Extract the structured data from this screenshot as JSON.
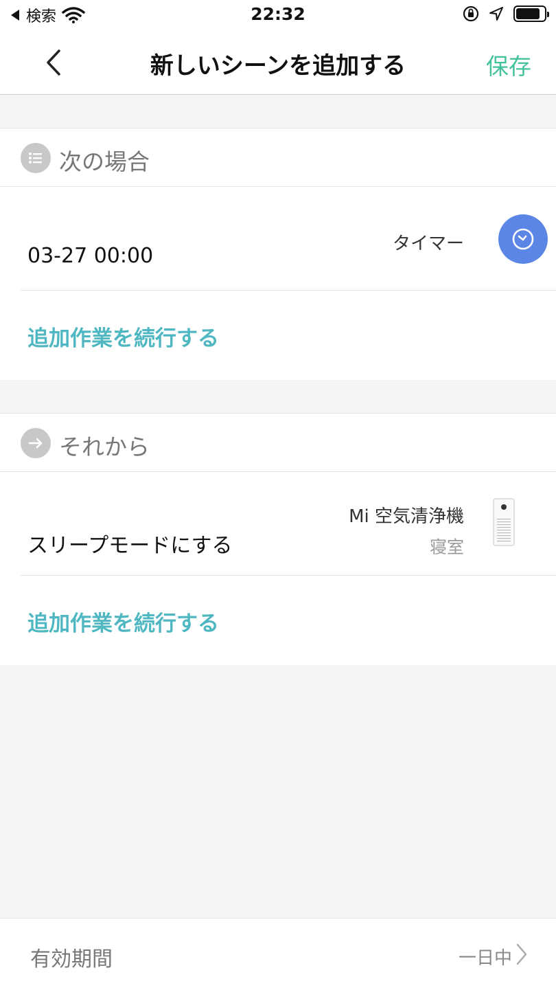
{
  "status_bar": {
    "back_app": "検索",
    "time": "22:32"
  },
  "nav": {
    "title": "新しいシーンを追加する",
    "save_label": "保存"
  },
  "condition_section": {
    "title": "次の場合",
    "item": {
      "value": "03-27 00:00",
      "type_label": "タイマー",
      "icon": "clock-icon"
    },
    "continue_label": "追加作業を続行する"
  },
  "action_section": {
    "title": "それから",
    "item": {
      "action": "スリープモードにする",
      "device_name": "Mi 空気清浄機",
      "room": "寝室",
      "icon": "air-purifier-icon"
    },
    "continue_label": "追加作業を続行する"
  },
  "footer": {
    "label": "有効期間",
    "value": "一日中"
  },
  "colors": {
    "accent_green": "#43c29d",
    "link_teal": "#4fb7c1",
    "timer_blue": "#5b86e5"
  }
}
